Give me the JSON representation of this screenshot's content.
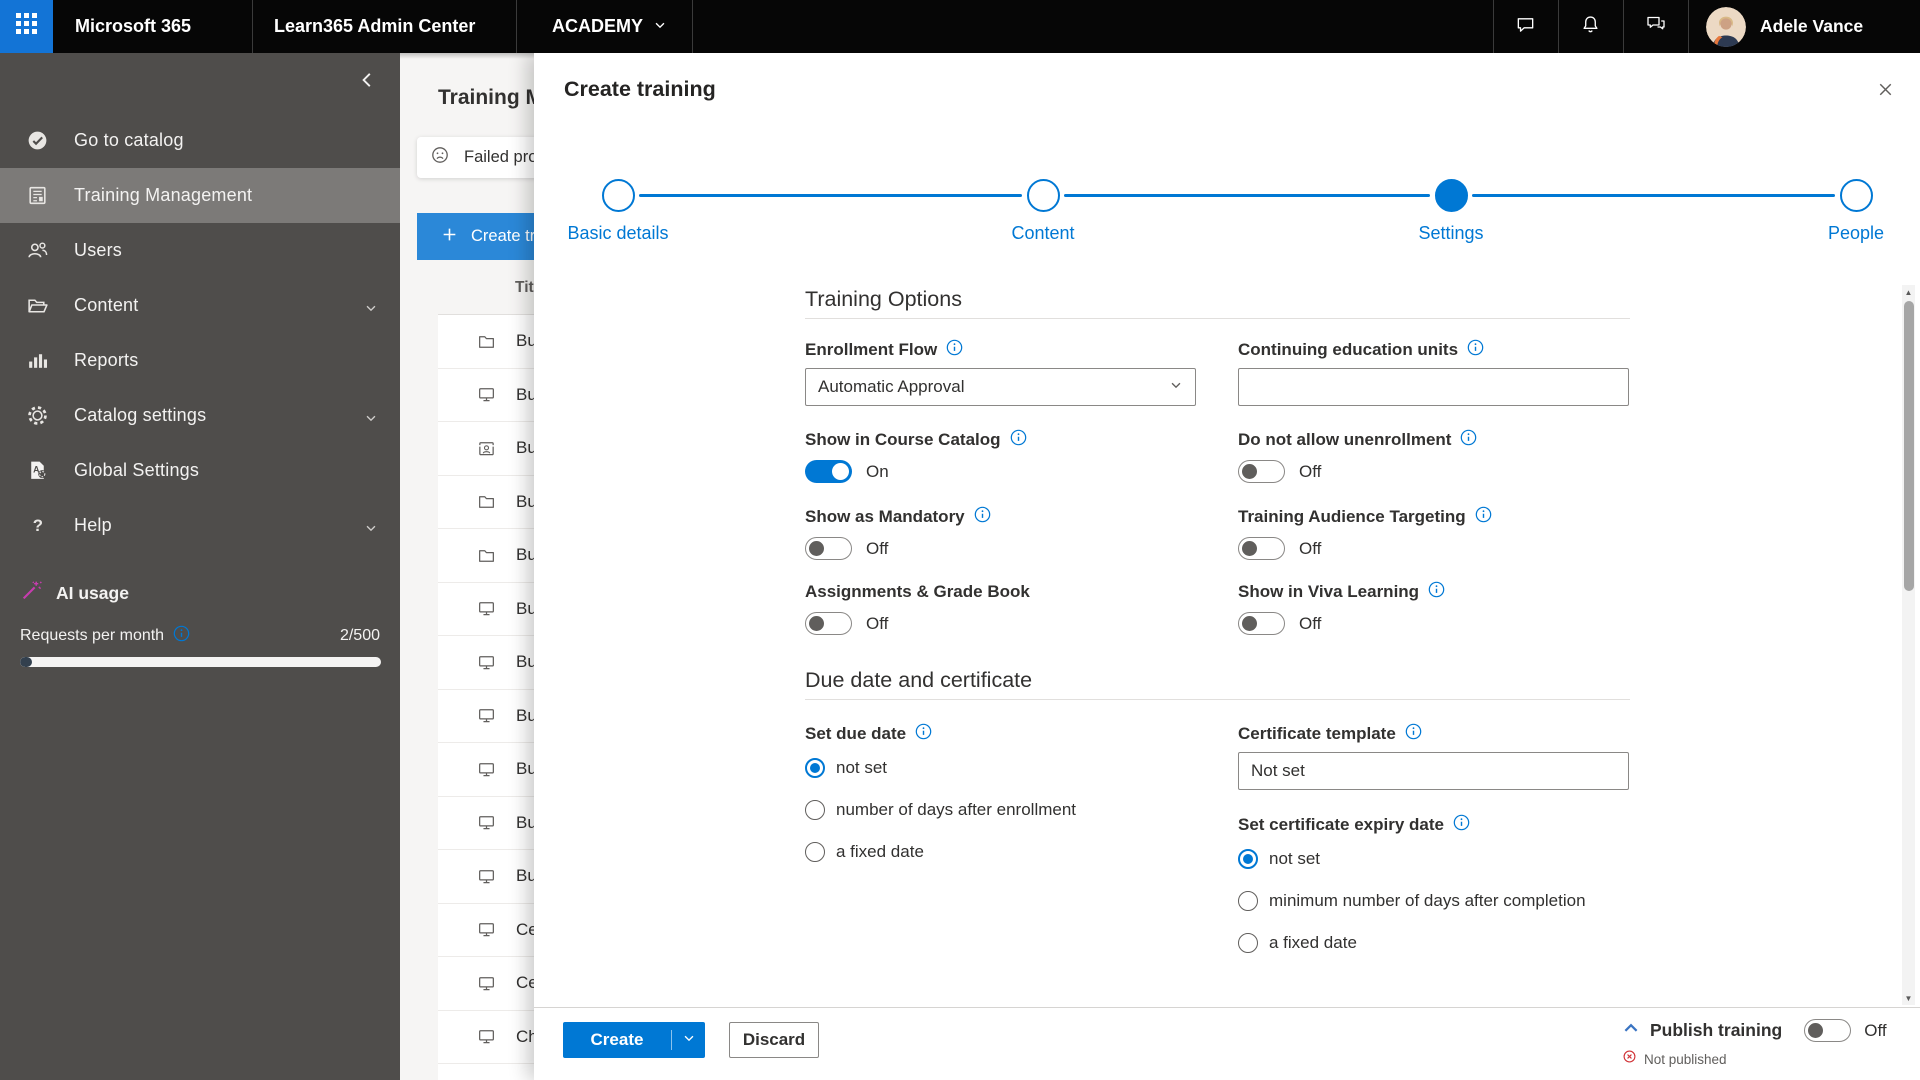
{
  "colors": {
    "accent": "#0078d4",
    "topbar_bg": "#060606",
    "app_launcher_bg": "#1374d6",
    "sidebar_bg": "#4f4d4b",
    "sidebar_active_bg": "#7c7a78",
    "ai_wand": "#c73caf",
    "error_red": "#d13438",
    "page_create_button_bg": "#2b88d8"
  },
  "topbar": {
    "brand": "Microsoft 365",
    "admin_center": "Learn365 Admin Center",
    "tenant": "ACADEMY",
    "user_name": "Adele Vance"
  },
  "sidebar": {
    "items": [
      {
        "label": "Go to catalog",
        "icon": "check-circle",
        "active": false,
        "expandable": false
      },
      {
        "label": "Training Management",
        "icon": "news",
        "active": true,
        "expandable": false
      },
      {
        "label": "Users",
        "icon": "users",
        "active": false,
        "expandable": false
      },
      {
        "label": "Content",
        "icon": "folder-open",
        "active": false,
        "expandable": true
      },
      {
        "label": "Reports",
        "icon": "bar-chart",
        "active": false,
        "expandable": false
      },
      {
        "label": "Catalog settings",
        "icon": "gear",
        "active": false,
        "expandable": true
      },
      {
        "label": "Global Settings",
        "icon": "doc-gear",
        "active": false,
        "expandable": false
      },
      {
        "label": "Help",
        "icon": "question",
        "active": false,
        "expandable": true
      }
    ],
    "ai_usage_label": "AI usage",
    "requests_label": "Requests per month",
    "requests_value": "2/500",
    "progress_value": 2,
    "progress_max": 500
  },
  "page": {
    "title": "Training M",
    "alert_text": "Failed pro",
    "create_button_label": "Create tra",
    "table_header": "Titl",
    "rows": [
      {
        "icon": "folder",
        "label": "Bu"
      },
      {
        "icon": "monitor",
        "label": "Bu"
      },
      {
        "icon": "person-badge",
        "label": "Bu"
      },
      {
        "icon": "folder",
        "label": "Bu"
      },
      {
        "icon": "folder",
        "label": "Bu"
      },
      {
        "icon": "monitor",
        "label": "Bu"
      },
      {
        "icon": "monitor",
        "label": "Bu"
      },
      {
        "icon": "monitor",
        "label": "Bu"
      },
      {
        "icon": "monitor",
        "label": "Bu"
      },
      {
        "icon": "monitor",
        "label": "Bu"
      },
      {
        "icon": "monitor",
        "label": "Bu"
      },
      {
        "icon": "monitor",
        "label": "Ce"
      },
      {
        "icon": "monitor",
        "label": "Ce"
      },
      {
        "icon": "monitor",
        "label": "Ch"
      }
    ]
  },
  "modal": {
    "title": "Create training",
    "steps": [
      {
        "label": "Basic details",
        "state": "incomplete"
      },
      {
        "label": "Content",
        "state": "incomplete"
      },
      {
        "label": "Settings",
        "state": "current"
      },
      {
        "label": "People",
        "state": "incomplete"
      }
    ],
    "training_options": {
      "heading": "Training Options",
      "fields": [
        {
          "id": "enrollment-flow",
          "label": "Enrollment Flow",
          "info": true,
          "control": "dropdown",
          "value": "Automatic Approval"
        },
        {
          "id": "continuing-education-units",
          "label": "Continuing education units",
          "info": true,
          "control": "textbox",
          "value": ""
        },
        {
          "id": "show-in-course-catalog",
          "label": "Show in Course Catalog",
          "info": true,
          "control": "toggle",
          "state": "On"
        },
        {
          "id": "do-not-allow-unenrollment",
          "label": "Do not allow unenrollment",
          "info": true,
          "control": "toggle",
          "state": "Off"
        },
        {
          "id": "show-as-mandatory",
          "label": "Show as Mandatory",
          "info": true,
          "control": "toggle",
          "state": "Off"
        },
        {
          "id": "training-audience-targeting",
          "label": "Training Audience Targeting",
          "info": true,
          "control": "toggle",
          "state": "Off"
        },
        {
          "id": "assignments-grade-book",
          "label": "Assignments & Grade Book",
          "info": false,
          "control": "toggle",
          "state": "Off"
        },
        {
          "id": "show-in-viva-learning",
          "label": "Show in Viva Learning",
          "info": true,
          "control": "toggle",
          "state": "Off"
        }
      ]
    },
    "due_date_certificate": {
      "heading": "Due date and certificate",
      "set_due_date": {
        "label": "Set due date",
        "info": true,
        "selected": 0,
        "options": [
          "not set",
          "number of days after enrollment",
          "a fixed date"
        ]
      },
      "certificate_template": {
        "label": "Certificate template",
        "info": true,
        "value": "Not set"
      },
      "set_certificate_expiry_date": {
        "label": "Set certificate expiry date",
        "info": true,
        "selected": 0,
        "options": [
          "not set",
          "minimum number of days after completion",
          "a fixed date"
        ]
      }
    },
    "footer": {
      "create_label": "Create",
      "discard_label": "Discard",
      "publish_label": "Publish training",
      "publish_state": "Off",
      "status": "Not published"
    }
  }
}
